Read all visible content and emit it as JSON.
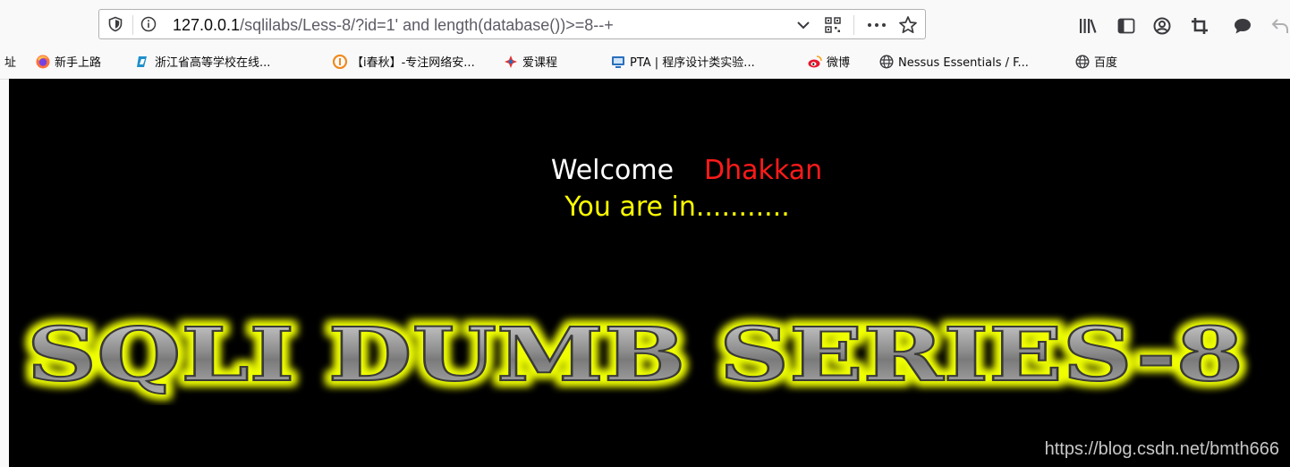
{
  "browser": {
    "url_host": "127.0.0.1",
    "url_path": "/sqlilabs/Less-8/?id=1' and length(database())>=8--+",
    "icons": [
      "shield-icon",
      "info-icon",
      "chevron-down-icon",
      "qr-code-icon",
      "more-icon",
      "star-icon",
      "library-icon",
      "sidebar-icon",
      "account-icon",
      "crop-icon",
      "chat-icon",
      "back-icon"
    ]
  },
  "bookmarks": {
    "items": [
      {
        "label": "址"
      },
      {
        "label": "新手上路",
        "icon": "firefox-icon"
      },
      {
        "label": "浙江省高等学校在线...",
        "icon": "book-icon"
      },
      {
        "label": "【i春秋】-专注网络安...",
        "icon": "ichunqiu-icon"
      },
      {
        "label": "爱课程",
        "icon": "icourse-icon"
      },
      {
        "label": "PTA | 程序设计类实验...",
        "icon": "pta-icon"
      },
      {
        "label": "微博",
        "icon": "weibo-icon"
      },
      {
        "label": "Nessus Essentials / F...",
        "icon": "globe-icon"
      },
      {
        "label": "百度",
        "icon": "globe-icon"
      }
    ]
  },
  "page": {
    "welcome_text": "Welcome",
    "user_name": "Dhakkan",
    "status": "You are in...........",
    "title_image_text": "SQLI DUMB SERIES-8",
    "watermark": "https://blog.csdn.net/bmth666",
    "colors": {
      "background": "#000000",
      "welcome": "#ffffff",
      "name": "#ff1a1a",
      "status": "#ffff00",
      "title_glow": "#f0ff00"
    }
  }
}
